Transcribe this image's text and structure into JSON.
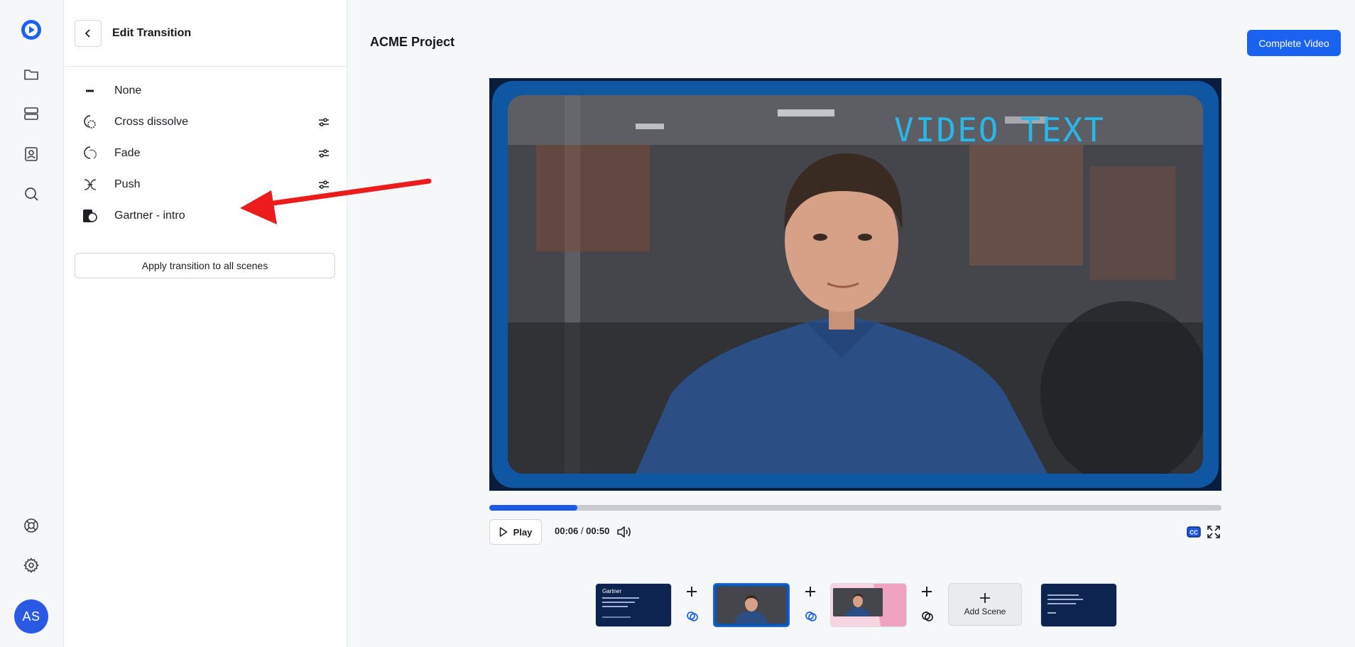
{
  "rail": {
    "items": [
      "logo-icon",
      "folder-icon",
      "server-icon",
      "contact-icon",
      "search-icon",
      "help-icon",
      "gear-icon"
    ],
    "avatar_initials": "AS"
  },
  "panel": {
    "title": "Edit Transition",
    "transitions": [
      {
        "label": "None",
        "icon": "minus-icon",
        "has_settings": false
      },
      {
        "label": "Cross dissolve",
        "icon": "cross-dissolve-icon",
        "has_settings": true
      },
      {
        "label": "Fade",
        "icon": "fade-icon",
        "has_settings": true
      },
      {
        "label": "Push",
        "icon": "push-icon",
        "has_settings": true
      },
      {
        "label": "Gartner - intro",
        "icon": "custom-transition-icon",
        "has_settings": false
      }
    ],
    "apply_label": "Apply transition to all scenes"
  },
  "main": {
    "project_title": "ACME Project",
    "complete_label": "Complete Video",
    "video_overlay_text": "VIDEO TEXT",
    "play_label": "Play",
    "time_current": "00:06",
    "time_separator": " / ",
    "time_total": "00:50",
    "progress_fraction": 0.12
  },
  "timeline": {
    "thumb1_title": "Gartner",
    "add_scene_label": "Add Scene"
  },
  "colors": {
    "accent": "#1a63f0",
    "annotation_arrow": "#ec1c1c",
    "video_frame": "#0f56a3",
    "overlay_text": "#29b6e8"
  }
}
